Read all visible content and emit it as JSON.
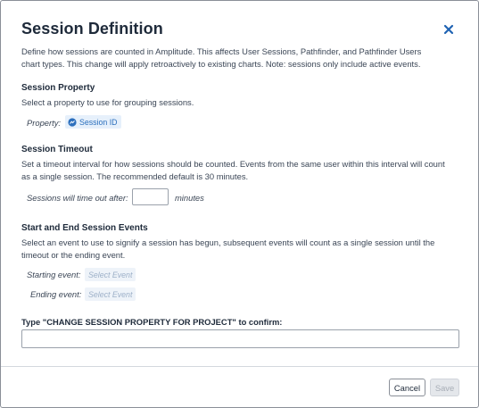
{
  "dialog": {
    "title": "Session Definition",
    "description_line1": "Define how sessions are counted in Amplitude. This affects User Sessions, Pathfinder, and Pathfinder Users",
    "description_line2": "chart types. This change will apply retroactively to existing charts. Note: sessions only include active events."
  },
  "session_property": {
    "title": "Session Property",
    "description": "Select a property to use for grouping sessions.",
    "property_label": "Property:",
    "property_value": "Session ID",
    "property_icon": "session-property-icon"
  },
  "session_timeout": {
    "title": "Session Timeout",
    "description_line1": "Set a timeout interval for how sessions should be counted. Events from the same user within this interval will count",
    "description_line2": "as a single session. The recommended default is 30 minutes.",
    "timeout_label": "Sessions will time out after:",
    "timeout_value": "",
    "timeout_unit": "minutes"
  },
  "session_events": {
    "title": "Start and End Session Events",
    "description_line1": "Select an event to use to signify a session has begun, subsequent events will count as a single session until the",
    "description_line2": "timeout or the ending event.",
    "starting_label": "Starting event:",
    "starting_placeholder": "Select Event",
    "ending_label": "Ending event:",
    "ending_placeholder": "Select Event"
  },
  "confirm": {
    "label": "Type \"CHANGE SESSION PROPERTY FOR PROJECT\" to confirm:",
    "value": ""
  },
  "footer": {
    "cancel_label": "Cancel",
    "save_label": "Save"
  },
  "colors": {
    "accent": "#2c6fbd",
    "close_icon": "#1f63b3",
    "chip_bg": "#e6f0fb",
    "save_disabled_bg": "#e4e7eb"
  }
}
